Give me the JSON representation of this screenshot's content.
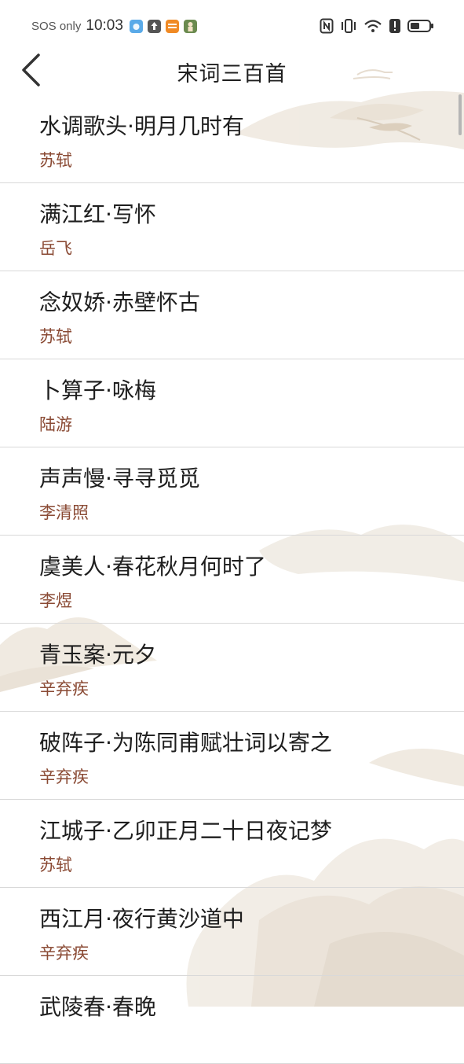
{
  "status_bar": {
    "carrier": "SOS only",
    "time": "10:03",
    "app_icons": [
      "weather-app-icon",
      "upload-app-icon",
      "reader-app-icon",
      "game-app-icon"
    ],
    "right_icons": [
      "nfc-icon",
      "vibrate-icon",
      "wifi-icon",
      "alert-icon",
      "battery-icon"
    ]
  },
  "header": {
    "title": "宋词三百首",
    "back_icon": "chevron-left-icon"
  },
  "poems": [
    {
      "title": "水调歌头·明月几时有",
      "author": "苏轼"
    },
    {
      "title": "满江红·写怀",
      "author": "岳飞"
    },
    {
      "title": "念奴娇·赤壁怀古",
      "author": "苏轼"
    },
    {
      "title": "卜算子·咏梅",
      "author": "陆游"
    },
    {
      "title": "声声慢·寻寻觅觅",
      "author": "李清照"
    },
    {
      "title": "虞美人·春花秋月何时了",
      "author": "李煜"
    },
    {
      "title": "青玉案·元夕",
      "author": "辛弃疾"
    },
    {
      "title": "破阵子·为陈同甫赋壮词以寄之",
      "author": "辛弃疾"
    },
    {
      "title": "江城子·乙卯正月二十日夜记梦",
      "author": "苏轼"
    },
    {
      "title": "西江月·夜行黄沙道中",
      "author": "辛弃疾"
    },
    {
      "title": "武陵春·春晚",
      "author": ""
    }
  ],
  "colors": {
    "author": "#8a4a34",
    "title": "#1e1e1e",
    "divider": "#d9d9d9"
  }
}
